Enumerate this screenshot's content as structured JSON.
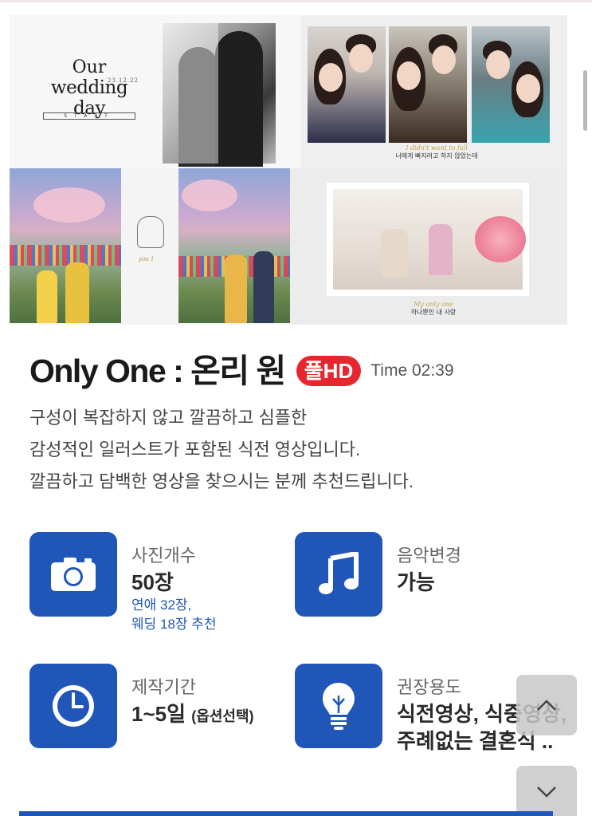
{
  "collage": {
    "intro_line1": "Our",
    "intro_line2": "wedding day",
    "intro_date": "23.12.22",
    "intro_start": "START",
    "selfie_caption_en": "I didn't want to fall",
    "selfie_caption_ko": "너에게 빠지려고 하지 않았는데",
    "sketch_caption": "you 1",
    "room_caption_en": "My only one",
    "room_caption_ko": "하나뿐인 내 사랑"
  },
  "product": {
    "title": "Only One : 온리 원",
    "badge": "풀HD",
    "time": "Time 02:39",
    "description": [
      "구성이 복잡하지 않고 깔끔하고 심플한",
      "감성적인 일러스트가 포함된 식전 영상입니다.",
      "깔끔하고 담백한 영상을 찾으시는 분께 추천드립니다."
    ]
  },
  "info": {
    "photos": {
      "icon": "camera-icon",
      "label": "사진개수",
      "value": "50장",
      "sub1": "연애 32장,",
      "sub2": "웨딩 18장 추천"
    },
    "music": {
      "icon": "music-note-icon",
      "label": "음악변경",
      "value": "가능"
    },
    "period": {
      "icon": "clock-icon",
      "label": "제작기간",
      "value": "1~5일",
      "value_small": "(옵션선택)"
    },
    "usage": {
      "icon": "lightbulb-icon",
      "label": "권장용도",
      "value1": "식전영상, 식중영상,",
      "value2": "주례없는 결혼식 .."
    }
  },
  "colors": {
    "accent": "#1f56b8",
    "badge": "#e8262f"
  }
}
